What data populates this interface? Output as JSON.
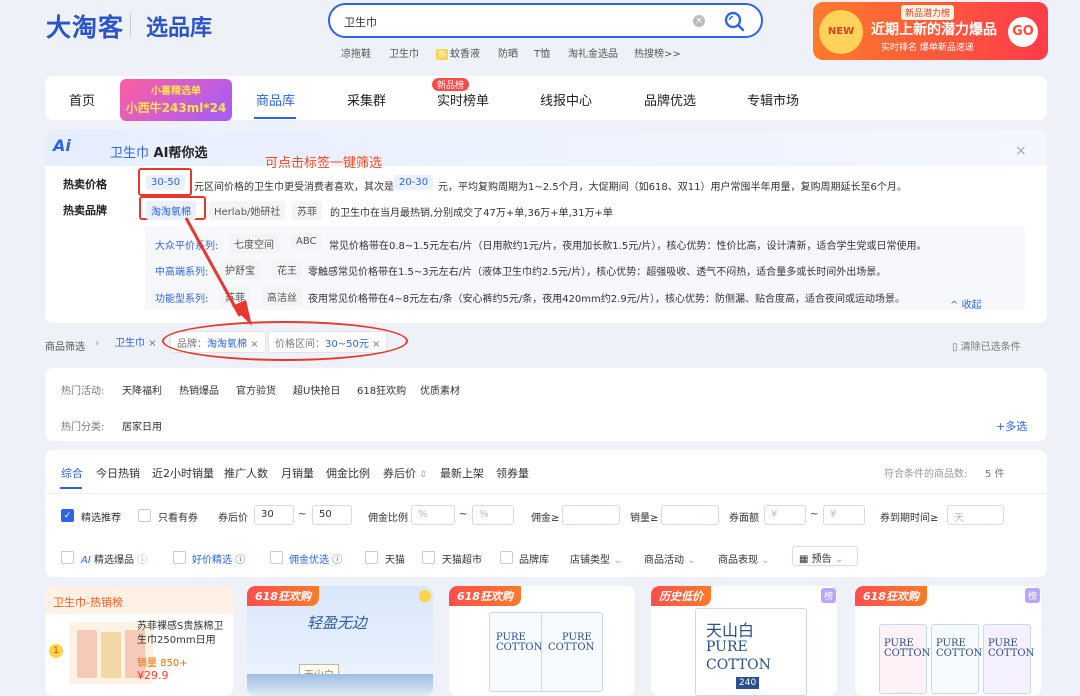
{
  "header": {
    "logo": "大淘客",
    "logo_sub": "选品库",
    "search_value": "卫生巾",
    "hot_keywords": [
      "凉拖鞋",
      "卫生巾",
      "蚊香液",
      "防晒",
      "T恤",
      "淘礼金选品",
      "热搜榜>>"
    ],
    "hot_badge": "热",
    "banner_tag": "新品潜力榜",
    "banner_new": "NEW",
    "banner_title": "近期上新的潜力爆品",
    "banner_sub": "实时排名 爆单新品速递",
    "banner_go": "GO"
  },
  "nav": {
    "items": [
      "首页",
      "商品库",
      "采集群",
      "实时榜单",
      "线报中心",
      "品牌优选",
      "专辑市场"
    ],
    "promo_top": "小喜精选单",
    "promo_bottom": "小西牛243ml*24",
    "hot_rank_badge": "新品榜"
  },
  "ai": {
    "logo": "Ai",
    "keyword": "卫生巾",
    "title": "AI帮你选",
    "hint": "可点击标签一键筛选",
    "close": "×",
    "price_label": "热卖价格",
    "price_tag": "30-50",
    "price_text1": "元区间价格的卫生巾更受消费者喜欢，其次是",
    "price_tag2": "20-30",
    "price_text2": "元，平均复购周期为1~2.5个月，大促期间（如618、双11）用户常囤半年用量，复购周期延长至6个月。",
    "brand_label": "热卖品牌",
    "brand_tags": [
      "淘淘氧棉",
      "Herlab/她研社",
      "苏菲"
    ],
    "brand_text": "的卫生巾在当月最热销,分别成交了47万+单,36万+单,31万+单",
    "series": [
      {
        "label": "大众平价系列:",
        "tags": [
          "七度空间",
          "ABC"
        ],
        "text": "常见价格带在0.8~1.5元左右/片（日用款约1元/片，夜用加长款1.5元/片），核心优势：性价比高，设计清新，适合学生党或日常使用。"
      },
      {
        "label": "中高端系列:",
        "tags": [
          "护舒宝",
          "花王"
        ],
        "text": "零触感常见价格带在1.5~3元左右/片（液体卫生巾约2.5元/片），核心优势：超强吸收、透气不闷热，适合量多或长时间外出场景。"
      },
      {
        "label": "功能型系列:",
        "tags": [
          "苏菲",
          "高洁丝"
        ],
        "text": "夜用常见价格带在4~8元左右/条（安心裤约5元/条，夜用420mm约2.9元/片），核心优势：防侧漏、贴合度高，适合夜间或运动场景。"
      }
    ],
    "collapse": "收起"
  },
  "crumb": {
    "label": "商品筛选",
    "chip1": "卫生巾",
    "chip2_key": "品牌：",
    "chip2_val": "淘淘氧棉",
    "chip3_key": "价格区间：",
    "chip3_val": "30~50元",
    "clear": "清除已选条件"
  },
  "category": {
    "activity_label": "热门活动:",
    "activities": [
      "天降福利",
      "热销爆品",
      "官方验货",
      "超U快抢日",
      "618狂欢购",
      "优质素材"
    ],
    "category_label": "热门分类:",
    "categories": [
      "居家日用"
    ],
    "more": "+多选"
  },
  "sort": {
    "items": [
      "综合",
      "今日热销",
      "近2小时销量",
      "推广人数",
      "月销量",
      "佣金比例",
      "券后价",
      "最新上架",
      "领券量"
    ],
    "count_label": "符合条件的商品数:",
    "count": "5 件"
  },
  "filters": {
    "recommend": "精选推荐",
    "only_coupon": "只看有券",
    "price_label": "券后价",
    "price_min": "30",
    "price_max": "50",
    "commission_label": "佣金比例",
    "pct": "%",
    "commission_min_label": "佣金≥",
    "sales_label": "销量≥",
    "coupon_label": "券面额",
    "yen": "¥",
    "expire_label": "券到期时间≥",
    "expire_ph": "天",
    "tilde": "~"
  },
  "filters2": {
    "ai_prefix": "AI",
    "items": [
      "精选爆品",
      "好价精选",
      "佣金优选",
      "天猫",
      "天猫超市",
      "品牌库"
    ],
    "dropdowns": [
      "店铺类型",
      "商品活动",
      "商品表现"
    ],
    "presale": "预告"
  },
  "cards": {
    "rank_title": "卫生巾-热销榜",
    "rank_item": "苏菲裸感S贵族棉卫生巾250mm日用",
    "rank_sales": "销量 850+",
    "rank_price": "¥29.9",
    "rank_num": "1",
    "c1_tag": "618狂欢购",
    "c1_art": "轻盈无边",
    "c1_brand": "天山白",
    "c2_tag": "618狂欢购",
    "c3_tag": "历史低价",
    "c3_badge": "榜",
    "c4_tag": "618狂欢购",
    "c4_badge": "榜",
    "pure": "PURE",
    "cotton": "COTTON",
    "brand": "天山白",
    "size": "240"
  }
}
